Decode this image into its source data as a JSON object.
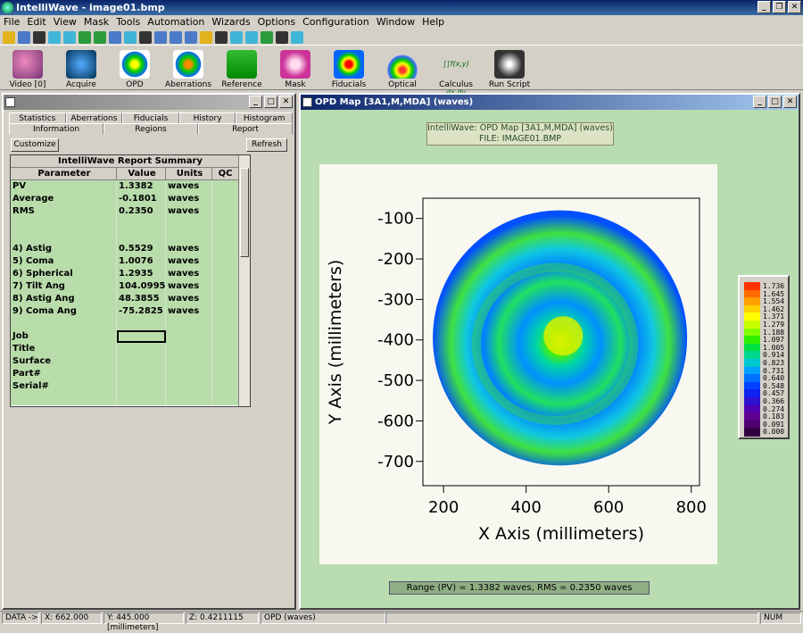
{
  "app": {
    "title": "IntelliWave - image01.bmp"
  },
  "menu": [
    "File",
    "Edit",
    "View",
    "Mask",
    "Tools",
    "Automation",
    "Wizards",
    "Options",
    "Configuration",
    "Window",
    "Help"
  ],
  "big_toolbar": [
    {
      "label": "Video [0]",
      "icon": "video-icon"
    },
    {
      "label": "Acquire",
      "icon": "camera-icon"
    },
    {
      "label": "OPD",
      "icon": "opd-icon"
    },
    {
      "label": "Aberrations",
      "icon": "aberrations-icon"
    },
    {
      "label": "Reference",
      "icon": "reference-icon"
    },
    {
      "label": "Mask",
      "icon": "mask-icon"
    },
    {
      "label": "Fiducials",
      "icon": "fiducials-icon"
    },
    {
      "label": "Optical",
      "icon": "optical-icon"
    },
    {
      "label": "Calculus",
      "icon": "calculus-icon",
      "glyph": "∫∫f(x,y) dx dy"
    },
    {
      "label": "Run Script",
      "icon": "lightning-icon"
    }
  ],
  "report_window": {
    "title": "",
    "tabs_row1": [
      "Statistics",
      "Aberrations",
      "Fiducials",
      "History",
      "Histogram"
    ],
    "tabs_row2": [
      "Information",
      "Regions",
      "Report"
    ],
    "customize_label": "Customize",
    "refresh_label": "Refresh",
    "table_title": "IntelliWave Report Summary",
    "columns": [
      "Parameter",
      "Value",
      "Units",
      "QC"
    ],
    "rows": [
      {
        "p": "PV",
        "v": "1.3382",
        "u": "waves"
      },
      {
        "p": "Average",
        "v": "-0.1801",
        "u": "waves"
      },
      {
        "p": "RMS",
        "v": "0.2350",
        "u": "waves"
      },
      {
        "p": "",
        "v": "",
        "u": ""
      },
      {
        "p": "",
        "v": "",
        "u": ""
      },
      {
        "p": " 4) Astig",
        "v": "0.5529",
        "u": "waves"
      },
      {
        "p": " 5) Coma",
        "v": "1.0076",
        "u": "waves"
      },
      {
        "p": " 6) Spherical",
        "v": "1.2935",
        "u": "waves"
      },
      {
        "p": " 7) Tilt Ang",
        "v": "104.0995",
        "u": "waves"
      },
      {
        "p": " 8) Astig Ang",
        "v": "48.3855",
        "u": "waves"
      },
      {
        "p": " 9) Coma Ang",
        "v": "-75.2825",
        "u": "waves"
      },
      {
        "p": "",
        "v": "",
        "u": ""
      },
      {
        "p": "Job",
        "v": "",
        "u": ""
      },
      {
        "p": "Title",
        "v": "",
        "u": ""
      },
      {
        "p": "Surface",
        "v": "",
        "u": ""
      },
      {
        "p": "Part#",
        "v": "",
        "u": ""
      },
      {
        "p": "Serial#",
        "v": "",
        "u": ""
      },
      {
        "p": "",
        "v": "",
        "u": ""
      }
    ]
  },
  "opd_window": {
    "title": "OPD Map [3A1,M,MDA]  (waves)",
    "header_line1": "IntelliWave: OPD Map [3A1,M,MDA]  (waves)",
    "header_line2": "FILE: IMAGE01.BMP",
    "footer": "Range (PV) =   1.3382 waves, RMS =   0.2350 waves"
  },
  "chart_data": {
    "type": "heatmap",
    "xlabel": "X Axis  (millimeters)",
    "ylabel": "Y Axis  (millimeters)",
    "x_ticks": [
      200,
      400,
      600,
      800
    ],
    "y_ticks": [
      -100,
      -200,
      -300,
      -400,
      -500,
      -600,
      -700
    ],
    "xlim": [
      150,
      820
    ],
    "ylim": [
      -760,
      -50
    ],
    "colorbar_labels": [
      "1.736",
      "1.645",
      "1.554",
      "1.462",
      "1.371",
      "1.279",
      "1.188",
      "1.097",
      "1.005",
      "0.914",
      "0.823",
      "0.731",
      "0.640",
      "0.548",
      "0.457",
      "0.366",
      "0.274",
      "0.183",
      "0.091",
      "0.000"
    ],
    "colorbar_colors": [
      "#ff3300",
      "#ff6a00",
      "#ffa000",
      "#ffd000",
      "#ffff00",
      "#c8ff00",
      "#80ff00",
      "#30f000",
      "#00e040",
      "#00d890",
      "#00c8d0",
      "#00a0ff",
      "#0070ff",
      "#0040ff",
      "#1020f0",
      "#3010d0",
      "#5000b0",
      "#600090",
      "#500070",
      "#300040"
    ]
  },
  "status_bar": {
    "data_label": "DATA ->",
    "x": "X:  662.000",
    "y": "Y:  445.000  [millimeters]",
    "z": "Z:      0.4211115",
    "mode": "OPD (waves)",
    "num": "NUM"
  }
}
